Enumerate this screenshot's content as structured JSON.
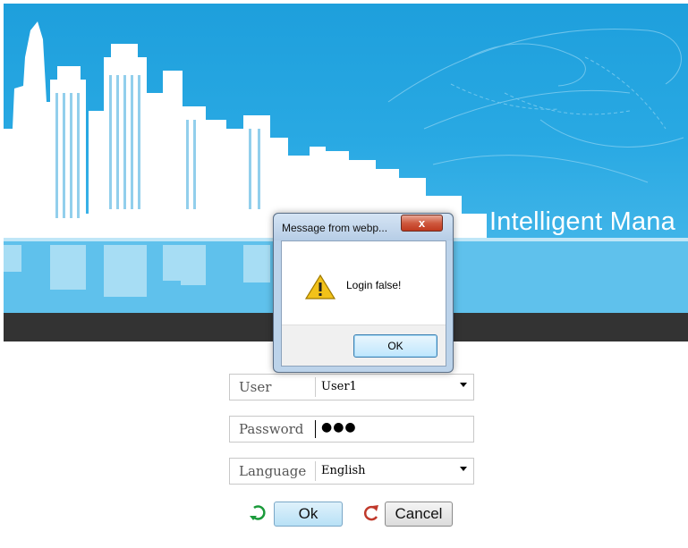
{
  "banner": {
    "title": "Intelligent Mana"
  },
  "form": {
    "user": {
      "label": "User",
      "value": "User1"
    },
    "password": {
      "label": "Password",
      "value": "●●●"
    },
    "language": {
      "label": "Language",
      "value": "English"
    },
    "ok_label": "Ok",
    "cancel_label": "Cancel"
  },
  "dialog": {
    "title": "Message from webp...",
    "close_label": "x",
    "message": "Login false!",
    "ok_label": "OK"
  },
  "colors": {
    "banner_blue": "#29a9e3",
    "dark_band": "#333333",
    "ok_icon": "#1a9a3a",
    "cancel_icon": "#c0392b"
  },
  "icons": {
    "ok": "refresh-green-icon",
    "cancel": "refresh-red-icon",
    "warning": "warning-icon",
    "close": "close-icon",
    "dropdown": "chevron-down-icon"
  }
}
